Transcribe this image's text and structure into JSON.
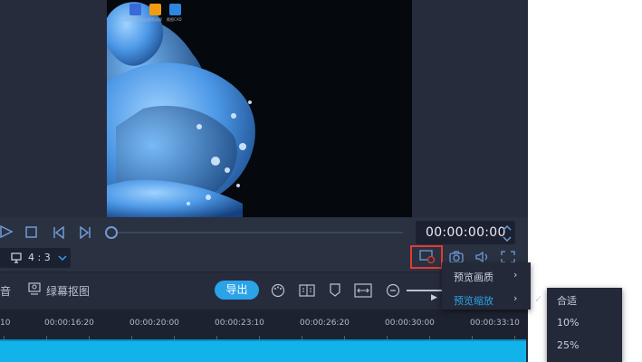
{
  "desktop_icons": [
    {
      "label": "a22222.png",
      "color": "#3a6ad9"
    },
    {
      "label": "截图录屏",
      "color": "#f39c12"
    },
    {
      "label": "截图CAD",
      "color": "#2e86de"
    }
  ],
  "player": {
    "timecode": "00:00:00:00",
    "aspect_ratio": "4 : 3"
  },
  "toolbar": {
    "audio_label": "音",
    "green_screen_label": "绿幕抠图",
    "export_label": "导出"
  },
  "timeline": {
    "ticks": [
      "10",
      "00:00:16:20",
      "00:00:20:00",
      "00:00:23:10",
      "00:00:26:20",
      "00:00:30:00",
      "00:00:33:10"
    ]
  },
  "preview_menu": {
    "items": [
      {
        "label": "预览画质",
        "active": false
      },
      {
        "label": "预览缩放",
        "active": true
      }
    ]
  },
  "zoom_menu": {
    "items": [
      {
        "label": "合适",
        "checked": true
      },
      {
        "label": "10%",
        "checked": false
      },
      {
        "label": "25%",
        "checked": false
      }
    ]
  },
  "colors": {
    "accent": "#2aa3e8",
    "track": "#12b3ea",
    "highlight_box": "#e53935"
  }
}
